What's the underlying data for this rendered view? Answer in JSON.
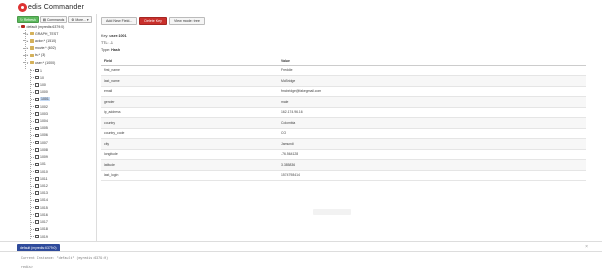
{
  "app": {
    "title": "edis Commander",
    "colors": {
      "brand": "#d33333",
      "refresh": "#5cb85c",
      "danger": "#c9302c",
      "console_tab": "#2f4b9b",
      "selected": "#c3d9f5"
    }
  },
  "left_toolbar": {
    "refresh_label": "Refresh",
    "commands_label": "Commands",
    "more_label": "More..."
  },
  "tree": {
    "connection": "default (myredis:6379:0)",
    "folders": [
      "GRAPH_TEST",
      "actor:* (1510)",
      "movie:* (602)",
      "ts:* (3)",
      "user:* (1000)"
    ],
    "keys": [
      "1",
      "10",
      "100",
      "1000",
      "1001",
      "1002",
      "1003",
      "1004",
      "1005",
      "1006",
      "1007",
      "1008",
      "1009",
      "101",
      "1010",
      "1011",
      "1012",
      "1013",
      "1014",
      "1015",
      "1016",
      "1017",
      "1018",
      "1019"
    ],
    "selected": "1001"
  },
  "toolbar": {
    "add_field": "Add New Field...",
    "delete_key": "Delete Key",
    "view_mode": "View mode: tree"
  },
  "key": {
    "key_label": "Key:",
    "key_name": "user:1001",
    "ttl_label": "TTL:",
    "ttl_value": "-1",
    "type_label": "Type:",
    "type_value": "Hash"
  },
  "table": {
    "headers": [
      "Field",
      "Value"
    ],
    "rows": [
      [
        "first_name",
        "Freddie"
      ],
      [
        "last_name",
        "McBridge"
      ],
      [
        "email",
        "fmcbridge@fakegmail.com"
      ],
      [
        "gender",
        "male"
      ],
      [
        "ip_address",
        "162.174.96.16"
      ],
      [
        "country",
        "Colombia"
      ],
      [
        "country_code",
        "CO"
      ],
      [
        "city",
        "Jamundi"
      ],
      [
        "longitude",
        "-76.564128"
      ],
      [
        "latitude",
        "3.385836"
      ],
      [
        "last_login",
        "1574798414"
      ]
    ]
  },
  "console": {
    "tab_label": "default (myredis:6379:0)",
    "close": "×",
    "line1": "Current Instance: \"default\" (myredis:6379:0)",
    "line2": "redis>"
  }
}
